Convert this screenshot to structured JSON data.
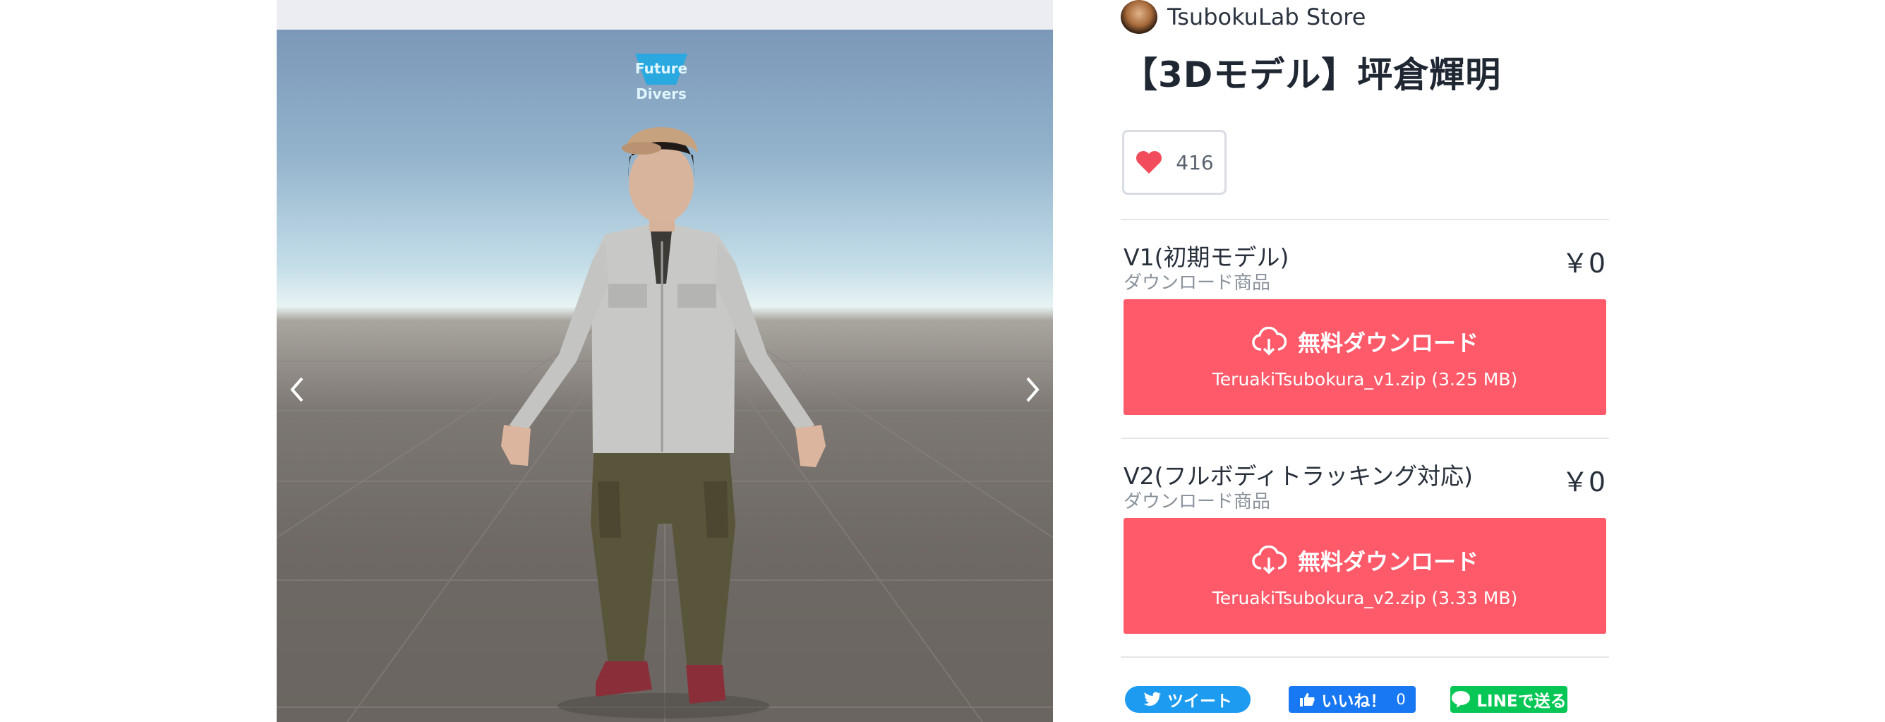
{
  "store": {
    "name": "TsubokuLab Store"
  },
  "product": {
    "title": "【3Dモデル】坪倉輝明",
    "likes": "416"
  },
  "viewer": {
    "logo_line1": "Future",
    "logo_line2": "Divers"
  },
  "items": [
    {
      "name": "V1(初期モデル)",
      "type": "ダウンロード商品",
      "price": "￥0",
      "button_label": "無料ダウンロード",
      "file": "TeruakiTsubokura_v1.zip (3.25 MB)"
    },
    {
      "name": "V2(フルボディトラッキング対応)",
      "type": "ダウンロード商品",
      "price": "￥0",
      "button_label": "無料ダウンロード",
      "file": "TeruakiTsubokura_v2.zip (3.33 MB)"
    }
  ],
  "share": {
    "tweet": "ツイート",
    "facebook": "いいね！",
    "facebook_count": "0",
    "line": "LINEで送る"
  },
  "colors": {
    "accent": "#ff5a6a",
    "twitter": "#1d9bf0",
    "facebook": "#1877f2",
    "line": "#06c755"
  }
}
